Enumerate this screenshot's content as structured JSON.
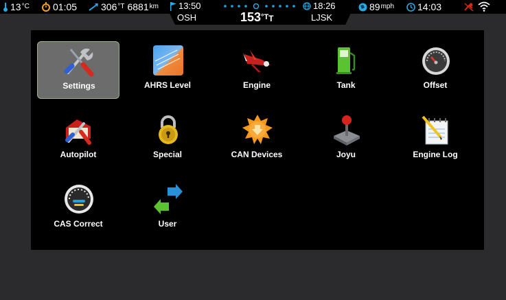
{
  "status": {
    "temperature": "13",
    "temp_unit": "°C",
    "timer": "01:05",
    "track": "306",
    "track_unit": "°T",
    "distance": "6881",
    "distance_unit": "km",
    "flag_time": "13:50",
    "from_airport": "OSH",
    "heading": "153",
    "heading_unit": "°T",
    "heading_sub": "T",
    "eta_time": "18:26",
    "to_airport": "LJSK",
    "speed": "89",
    "speed_unit": "mph",
    "clock": "14:03"
  },
  "apps": [
    {
      "label": "Settings",
      "icon": "settings-icon",
      "selected": true
    },
    {
      "label": "AHRS Level",
      "icon": "ahrs-level-icon"
    },
    {
      "label": "Engine",
      "icon": "engine-icon"
    },
    {
      "label": "Tank",
      "icon": "tank-icon"
    },
    {
      "label": "Offset",
      "icon": "offset-icon"
    },
    {
      "label": "Autopilot",
      "icon": "autopilot-icon"
    },
    {
      "label": "Special",
      "icon": "special-icon"
    },
    {
      "label": "CAN Devices",
      "icon": "can-devices-icon"
    },
    {
      "label": "Joyu",
      "icon": "joyu-icon"
    },
    {
      "label": "Engine Log",
      "icon": "engine-log-icon"
    },
    {
      "label": "CAS Correct",
      "icon": "cas-correct-icon"
    },
    {
      "label": "User",
      "icon": "user-icon"
    }
  ],
  "colors": {
    "accent": "#2a9fd6",
    "selected_bg": "#6c6c6c",
    "panel": "#000000",
    "background": "#2b2b2d"
  }
}
